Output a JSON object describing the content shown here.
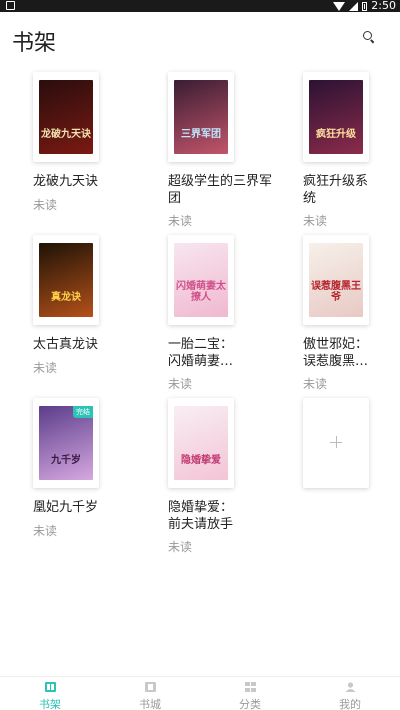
{
  "status_bar": {
    "time": "2:50"
  },
  "header": {
    "title": "书架",
    "search_icon": "search-icon"
  },
  "books": [
    {
      "title": "龙破九天诀",
      "status": "未读",
      "cover_text": "龙破九天诀",
      "cover_colors": [
        "#2a0d0d",
        "#7a1a12"
      ],
      "cover_text_color": "#f3e0b0"
    },
    {
      "title": "超级学生的三界军团",
      "status": "未读",
      "cover_text": "三界军团",
      "cover_colors": [
        "#3a1d33",
        "#c2556a"
      ],
      "cover_text_color": "#bfe8ff"
    },
    {
      "title": "疯狂升级系统",
      "status": "未读",
      "cover_text": "疯狂升级",
      "cover_colors": [
        "#2b1233",
        "#8c2b4a"
      ],
      "cover_text_color": "#ffe0a0"
    },
    {
      "title": "太古真龙诀",
      "status": "未读",
      "cover_text": "真龙诀",
      "cover_colors": [
        "#1e1206",
        "#b5511a"
      ],
      "cover_text_color": "#ffd24a"
    },
    {
      "title": "一胎二宝：闪婚萌妻…",
      "status": "未读",
      "cover_text": "闪婚萌妻太撩人",
      "cover_colors": [
        "#f7e6ef",
        "#f0b8cf"
      ],
      "cover_text_color": "#d0508a"
    },
    {
      "title": "傲世邪妃：误惹腹黑…",
      "status": "未读",
      "cover_text": "误惹腹黑王爷",
      "cover_colors": [
        "#f6f0ea",
        "#e8c9c4"
      ],
      "cover_text_color": "#b5262e"
    },
    {
      "title": "凰妃九千岁",
      "status": "未读",
      "cover_text": "九千岁",
      "cover_colors": [
        "#5b3d8a",
        "#d6a8e0"
      ],
      "cover_text_color": "#3a1a45",
      "badge": "完结"
    },
    {
      "title": "隐婚挚爱：前夫请放手",
      "status": "未读",
      "cover_text": "隐婚挚爱",
      "cover_colors": [
        "#f8eef3",
        "#f3c4d6"
      ],
      "cover_text_color": "#c23b74"
    }
  ],
  "add_book": {
    "icon": "plus-icon"
  },
  "tabs": [
    {
      "label": "书架",
      "icon": "bookshelf-icon",
      "active": true
    },
    {
      "label": "书城",
      "icon": "bookstore-icon",
      "active": false
    },
    {
      "label": "分类",
      "icon": "category-icon",
      "active": false
    },
    {
      "label": "我的",
      "icon": "profile-icon",
      "active": false
    }
  ],
  "colors": {
    "accent": "#2bc3b5",
    "muted": "#999999",
    "text": "#222222"
  }
}
